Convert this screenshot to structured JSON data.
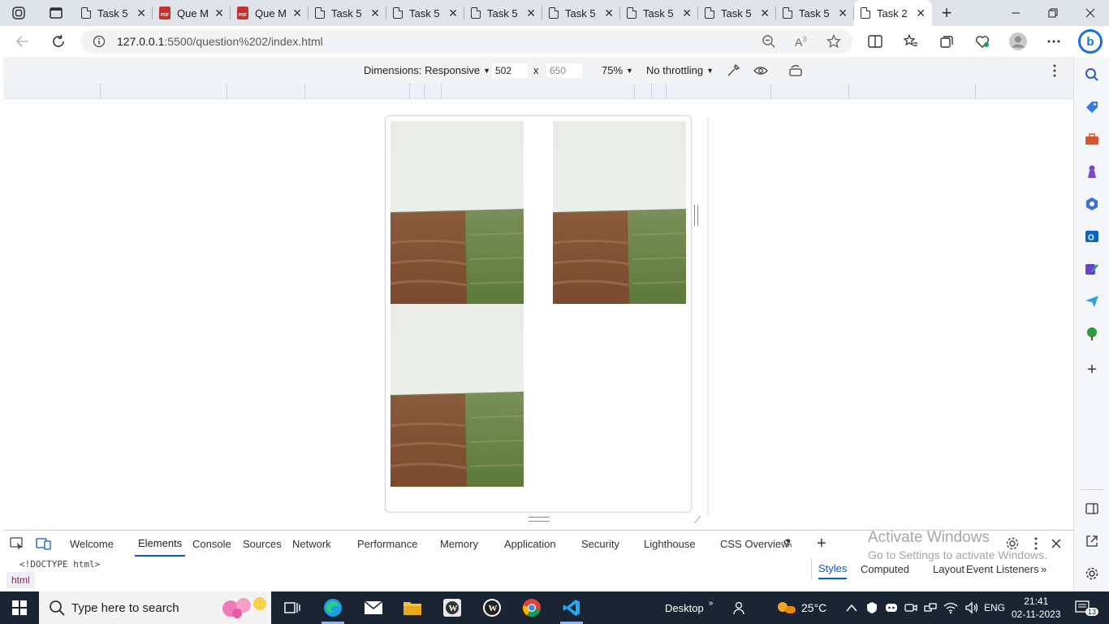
{
  "browser": {
    "tabs": [
      {
        "label": "Task 5",
        "icon": "document-icon"
      },
      {
        "label": "Que M",
        "icon": "pdf-icon"
      },
      {
        "label": "Que M",
        "icon": "pdf-icon"
      },
      {
        "label": "Task 5",
        "icon": "document-icon"
      },
      {
        "label": "Task 5",
        "icon": "document-icon"
      },
      {
        "label": "Task 5",
        "icon": "document-icon"
      },
      {
        "label": "Task 5",
        "icon": "document-icon"
      },
      {
        "label": "Task 5",
        "icon": "document-icon"
      },
      {
        "label": "Task 5",
        "icon": "document-icon"
      },
      {
        "label": "Task 5",
        "icon": "document-icon"
      },
      {
        "label": "Task 2",
        "icon": "document-icon",
        "active": true
      }
    ],
    "pdf_badge": "PDF",
    "url_host": "127.0.0.1",
    "url_path": ":5500/question%202/index.html",
    "bing_letter": "b"
  },
  "device_toolbar": {
    "dimensions_label": "Dimensions: Responsive",
    "width": "502",
    "times": "x",
    "height": "650",
    "zoom": "75%",
    "throttling": "No throttling"
  },
  "page": {
    "images": [
      {
        "alt": "field photo 1"
      },
      {
        "alt": "field photo 2"
      },
      {
        "alt": "field photo 3"
      }
    ]
  },
  "devtools": {
    "tabs": [
      "Welcome",
      "Elements",
      "Console",
      "Sources",
      "Network",
      "Performance",
      "Memory",
      "Application",
      "Security",
      "Lighthouse",
      "CSS Overview"
    ],
    "active_tab": "Elements",
    "code_line": "<!DOCTYPE html>",
    "breadcrumb": "html",
    "styles_tabs": [
      "Styles",
      "Computed",
      "Layout",
      "Event Listeners"
    ],
    "active_styles_tab": "Styles"
  },
  "watermark": {
    "line1": "Activate Windows",
    "line2": "Go to Settings to activate Windows."
  },
  "taskbar": {
    "search_placeholder": "Type here to search",
    "desktop_label": "Desktop",
    "weather": "25°C",
    "language": "ENG",
    "time": "21:41",
    "date": "02-11-2023",
    "notification_count": "13"
  },
  "colors": {
    "accent": "#0b57d0",
    "tabstrip": "#dfe3ea",
    "taskbar": "#1b2433",
    "sky": "#eef0ec",
    "soil": "#7a4a2e",
    "grass": "#5c7a3a"
  }
}
